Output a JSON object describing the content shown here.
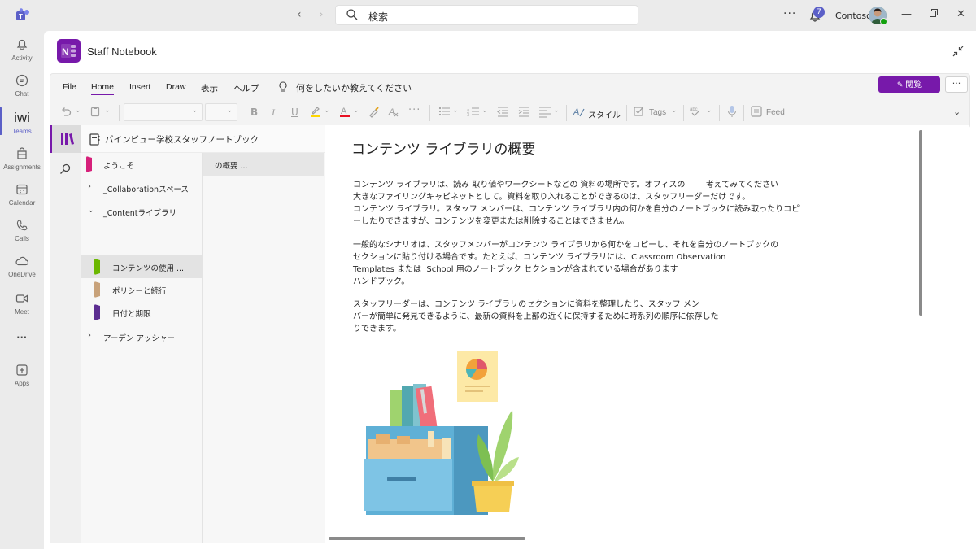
{
  "topbar": {
    "search_placeholder": "検索",
    "more": "···",
    "notification_count": "7",
    "org_name": "Contoso"
  },
  "rail": {
    "items": [
      {
        "label": "Activity",
        "icon": "bell-icon"
      },
      {
        "label": "Chat",
        "icon": "chat-icon"
      },
      {
        "label": "Teams",
        "icon": "teams-icon",
        "glyph": "iwi",
        "active": true
      },
      {
        "label": "Assignments",
        "icon": "assignments-icon"
      },
      {
        "label": "Calendar",
        "icon": "calendar-icon"
      },
      {
        "label": "Calls",
        "icon": "phone-icon"
      },
      {
        "label": "OneDrive",
        "icon": "cloud-icon"
      },
      {
        "label": "Meet",
        "icon": "video-icon"
      },
      {
        "label": "···",
        "icon": "more-icon"
      },
      {
        "label": "Apps",
        "icon": "apps-icon"
      }
    ]
  },
  "app": {
    "title": "Staff Notebook"
  },
  "ribbon": {
    "tabs": [
      "File",
      "Home",
      "Insert",
      "Draw",
      "表示",
      "ヘルプ"
    ],
    "active_tab": "Home",
    "tellme": "何をしたいか教えてください",
    "view_button": "閲覧",
    "more": "···",
    "style_label": "スタイル",
    "tags_label": "Tags",
    "feed_label": "Feed"
  },
  "notebook": {
    "title": "パインビュー学校スタッフノートブック",
    "sections": [
      {
        "label": "ようこそ",
        "color": "#d6207a",
        "type": "section"
      },
      {
        "label": "_Collaborationスペース",
        "type": "group"
      },
      {
        "label": "_Contentライブラリ",
        "type": "group",
        "expanded": true
      },
      {
        "label": "コンテンツの使用 ...",
        "color": "#6bb700",
        "type": "child",
        "selected": true
      },
      {
        "label": "ポリシーと続行",
        "color": "#c8a27a",
        "type": "child"
      },
      {
        "label": "日付と期限",
        "color": "#5c2e91",
        "type": "child"
      },
      {
        "label": "アーデン アッシャー",
        "type": "group"
      }
    ],
    "pages": [
      {
        "label": "の概要 ...",
        "selected": true
      }
    ]
  },
  "page": {
    "title": "コンテンツ ライブラリの概要",
    "p1_l1": "コンテンツ ライブラリは、読み 取り値やワークシートなどの 資料の場所です。オフィスの        考えてみてください",
    "p1_l2": "大きなファイリングキャビネットとして。資料を取り入れることができるのは、スタッフリーダーだけです。",
    "p1_l3": "コンテンツ ライブラリ。スタッフ メンバーは、コンテンツ ライブラリ内の何かを自分のノートブックに読み取ったりコピ",
    "p1_l4": "ーしたりできますが、コンテンツを変更または削除することはできません。",
    "p2_l1": "一般的なシナリオは、スタッフメンバーがコンテンツ ライブラリから何かをコピーし、それを自分のノートブックの",
    "p2_l2": "セクションに貼り付ける場合です。たとえば、コンテンツ ライブラリには、Classroom Observation",
    "p2_l3": "Templates または  School 用のノートブック セクションが含まれている場合があります",
    "p2_l4": "ハンドブック。",
    "p3_l1": "スタッフリーダーは、コンテンツ ライブラリのセクションに資料を整理したり、スタッフ メン",
    "p3_l2": "バーが簡単に発見できるように、最新の資料を上部の近くに保持するために時系列の順序に依存した",
    "p3_l3": "りできます。"
  },
  "colors": {
    "onenote_purple": "#7719aa",
    "teams_purple": "#5b5fc7"
  }
}
